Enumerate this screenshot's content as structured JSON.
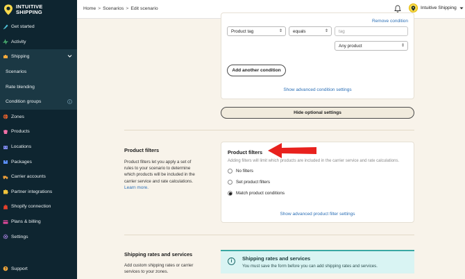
{
  "brand": {
    "line1": "INTUITIVE",
    "line2": "SHIPPING"
  },
  "breadcrumb": [
    "Home",
    "Scenarios",
    "Edit scenario"
  ],
  "account": {
    "name": "Intuitive Shipping"
  },
  "sidebar": {
    "items": [
      {
        "label": "Get started",
        "icon": "rocket-icon"
      },
      {
        "label": "Activity",
        "icon": "activity-icon"
      },
      {
        "label": "Shipping",
        "icon": "shipping-icon",
        "expanded": true
      },
      {
        "label": "Scenarios",
        "sub": true
      },
      {
        "label": "Rate blending",
        "sub": true
      },
      {
        "label": "Condition groups",
        "sub": true,
        "badge": "info-icon"
      },
      {
        "label": "Zones",
        "icon": "globe-icon"
      },
      {
        "label": "Products",
        "icon": "tag-icon"
      },
      {
        "label": "Locations",
        "icon": "building-icon"
      },
      {
        "label": "Packages",
        "icon": "box-icon"
      },
      {
        "label": "Carrier accounts",
        "icon": "truck-icon"
      },
      {
        "label": "Partner integrations",
        "icon": "puzzle-icon"
      },
      {
        "label": "Shopify connection",
        "icon": "shopify-icon"
      },
      {
        "label": "Plans & billing",
        "icon": "card-icon"
      },
      {
        "label": "Settings",
        "icon": "gear-icon"
      }
    ],
    "support": "Support"
  },
  "conditions": {
    "remove_link": "Remove condition",
    "field_select": "Product tag",
    "operator_select": "equals",
    "value_placeholder": "tag",
    "match_select": "Any product",
    "add_button": "Add another condition",
    "advanced_link": "Show advanced condition settings"
  },
  "hide_optional_button": "Hide optional settings",
  "product_filters": {
    "section_title": "Product filters",
    "section_desc": "Product filters let you apply a set of rules to your scenario to determine which products will be included in the carrier service and rate calculations.",
    "learn_more": "Learn more.",
    "card_title": "Product filters",
    "card_help": "Adding filters will limit which products are included in the carrier service and rate calculations.",
    "options": [
      "No filters",
      "Set product filters",
      "Match product conditions"
    ],
    "selected_index": 2,
    "advanced_link": "Show advanced product filter settings"
  },
  "shipping_rates": {
    "section_title": "Shipping rates and services",
    "section_desc": "Add custom shipping rates or carrier services to your zones.",
    "banner_title": "Shipping rates and services",
    "banner_text": "You must save the form before you can add shipping rates and services."
  },
  "colors": {
    "sidebar_bg": "#0e2530",
    "page_bg": "#f8f3ea",
    "annotation_arrow": "#e8211d",
    "banner_bg": "#d9f4f3"
  }
}
